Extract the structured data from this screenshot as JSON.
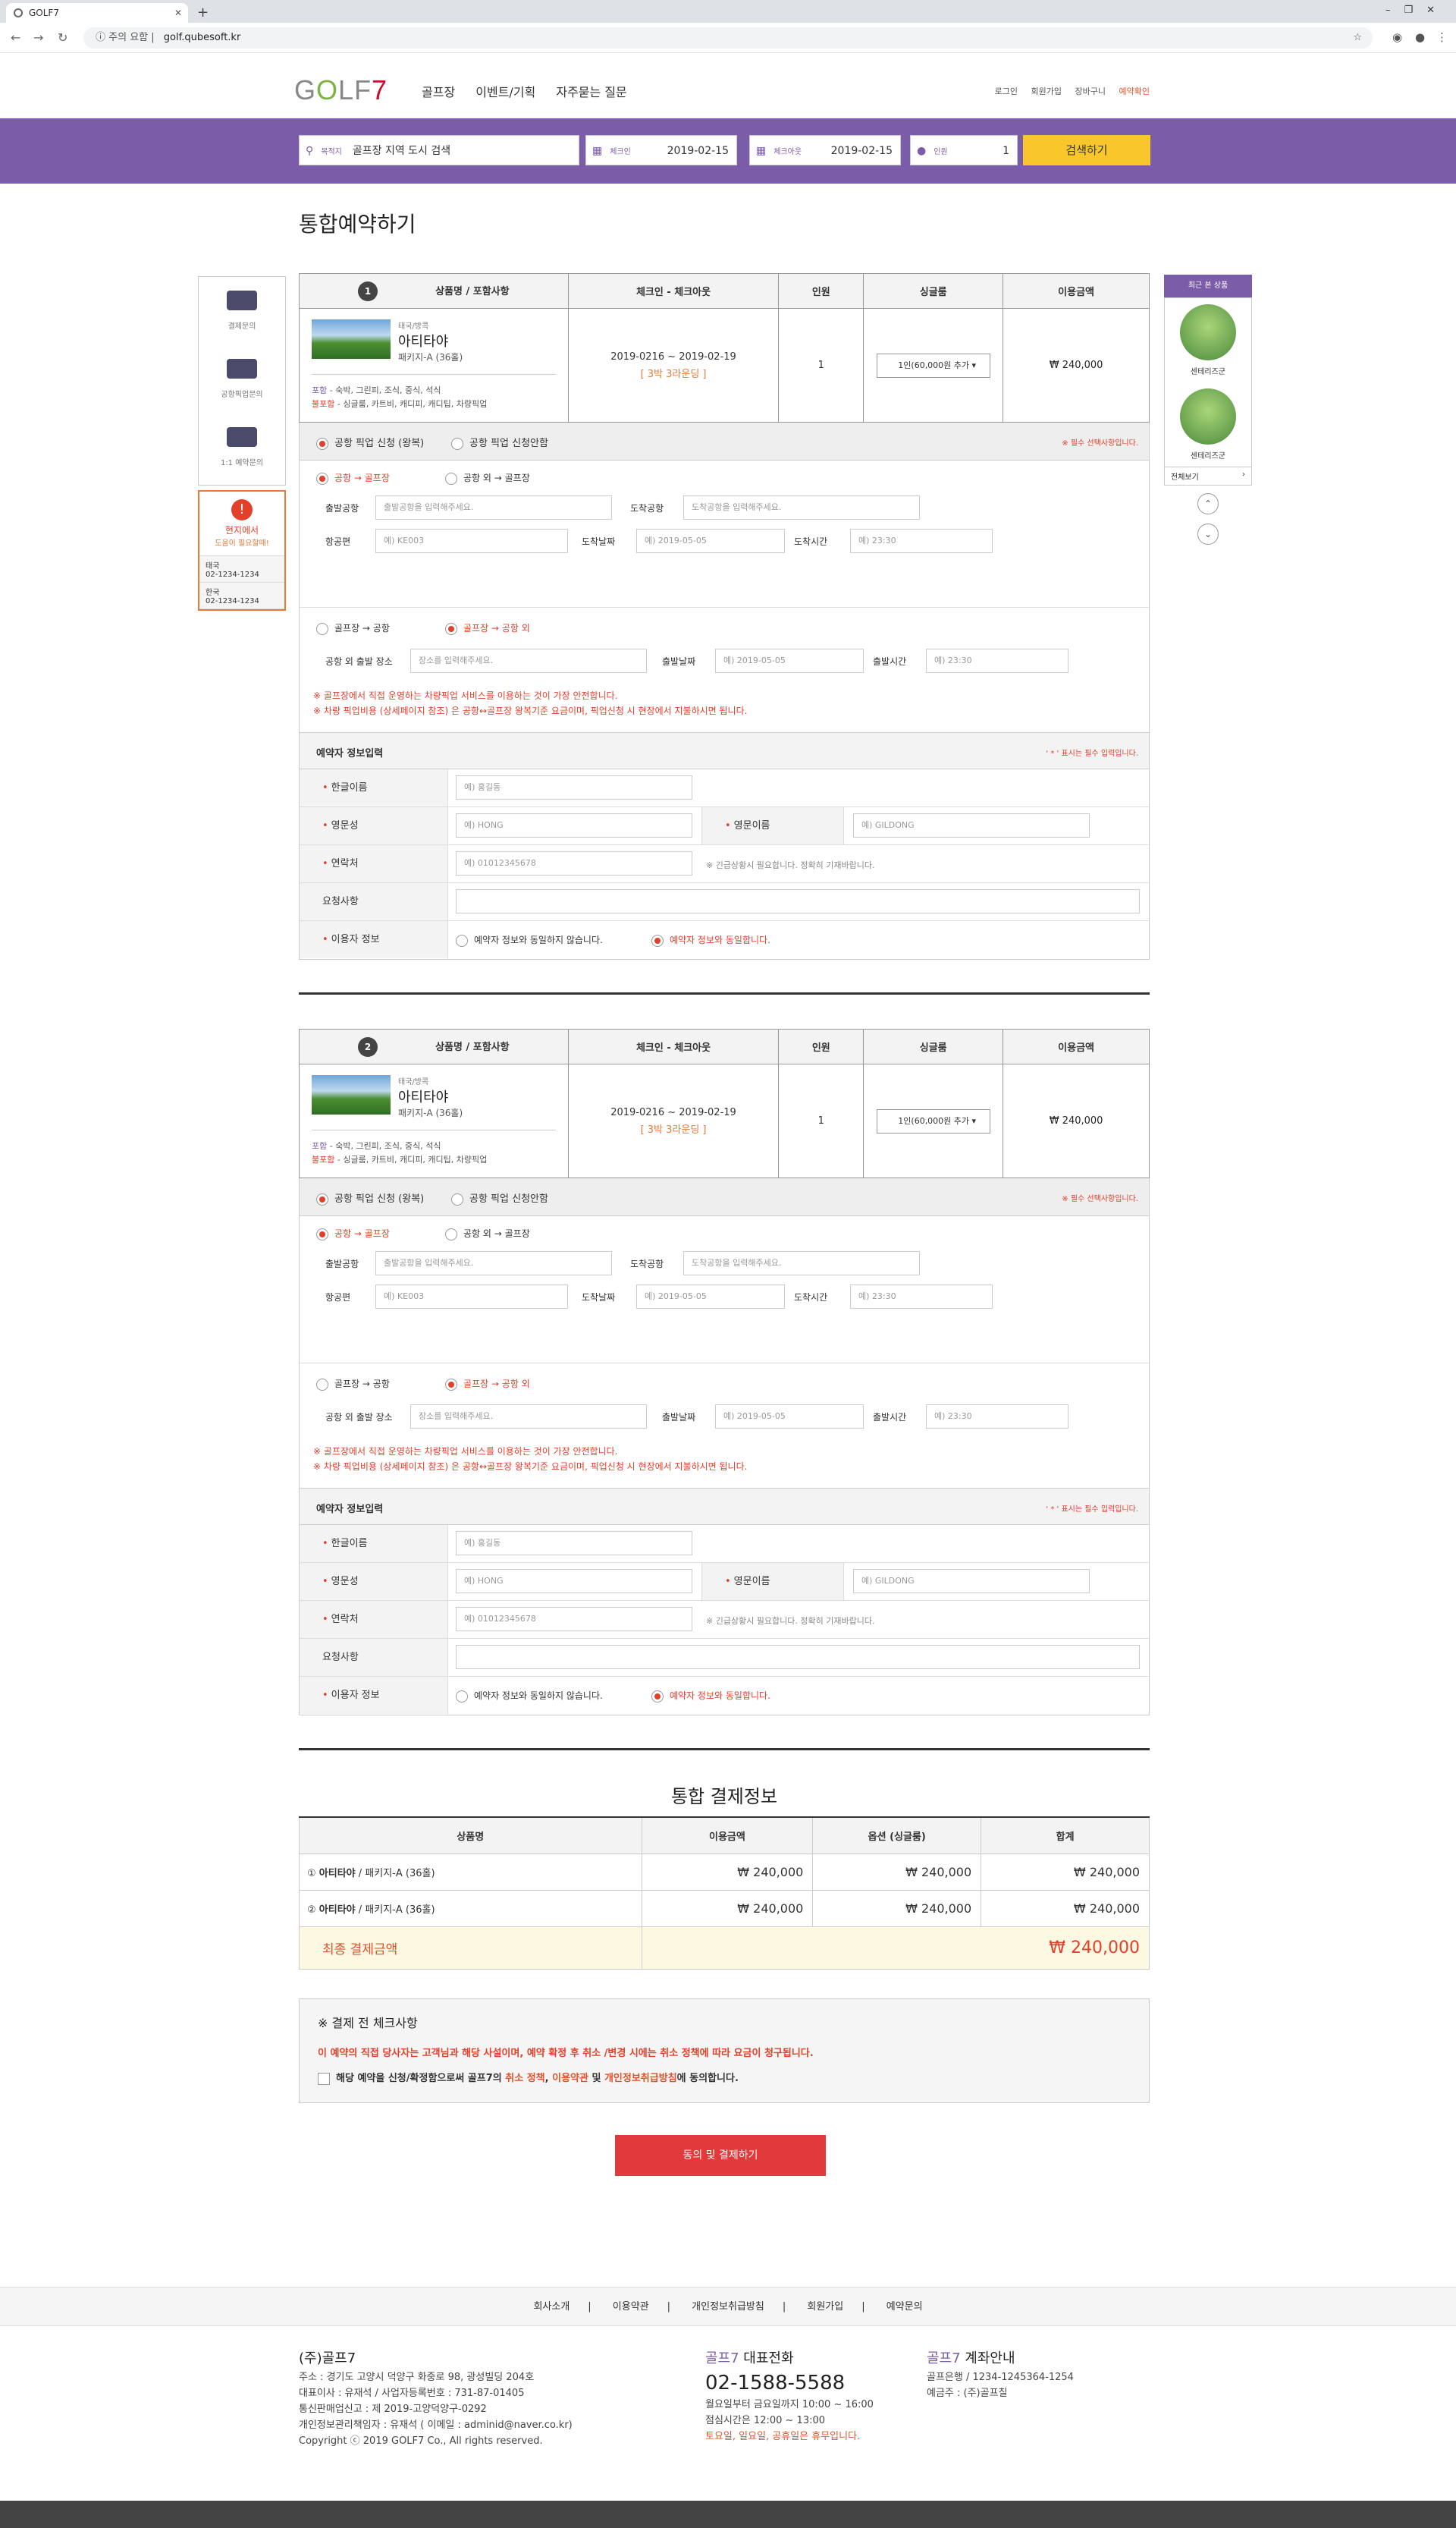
{
  "browser": {
    "tab_title": "GOLF7",
    "security": "주의 요함",
    "url": "golf.qubesoft.kr"
  },
  "header": {
    "logo": {
      "g": "G",
      "o": "O",
      "lf": "LF",
      "seven": "7"
    },
    "nav": [
      "골프장",
      "이벤트/기획",
      "자주묻는 질문"
    ],
    "util": [
      "로그인",
      "회원가입",
      "장바구니",
      "예약확인"
    ]
  },
  "search": {
    "dest_label": "목적지",
    "dest_value": "골프장 지역 도시 검색",
    "checkin_label": "체크인",
    "checkin_value": "2019-02-15",
    "checkout_label": "체크아웃",
    "checkout_value": "2019-02-15",
    "pax_label": "인원",
    "pax_value": "1",
    "button": "검색하기"
  },
  "page_title": "통합예약하기",
  "left_side": {
    "items": [
      "결제문의",
      "공항픽업문의",
      "1:1 예약문의"
    ],
    "help_title": "현지에서",
    "help_sub": "도움이 필요할때!",
    "phones": [
      {
        "country": "태국",
        "number": "02-1234-1234"
      },
      {
        "country": "한국",
        "number": "02-1234-1234"
      }
    ]
  },
  "right_side": {
    "title": "최근 본 상품",
    "items": [
      "센테리즈군",
      "센테리즈군"
    ],
    "more": "전체보기"
  },
  "table_headers": [
    "상품명 / 포함사항",
    "체크인 - 체크아웃",
    "인원",
    "싱글룸",
    "이용금액"
  ],
  "bookings": [
    {
      "num": "1",
      "region": "태국/방콕",
      "name": "아티타야",
      "package": "패키지-A (36홀)",
      "inc_label": "포함",
      "inc_text": " - 숙박, 그린피, 조식, 중식, 석식",
      "exc_label": "불포함",
      "exc_text": " - 싱글룸, 카트비, 캐디피, 캐디팁, 차량픽업",
      "dates": "2019-0216 ~ 2019-02-19",
      "nights": "[ 3박 3라운딩 ]",
      "pax": "1",
      "single_room": "1인(60,000원 추가",
      "price": "₩ 240,000"
    },
    {
      "num": "2",
      "region": "태국/방콕",
      "name": "아티타야",
      "package": "패키지-A (36홀)",
      "inc_label": "포함",
      "inc_text": " - 숙박, 그린피, 조식, 중식, 석식",
      "exc_label": "불포함",
      "exc_text": " - 싱글룸, 카트비, 캐디피, 캐디팁, 차량픽업",
      "dates": "2019-0216 ~ 2019-02-19",
      "nights": "[ 3박 3라운딩 ]",
      "pax": "1",
      "single_room": "1인(60,000원 추가",
      "price": "₩ 240,000"
    }
  ],
  "pickup": {
    "apply": "공항 픽업 신청 (왕복)",
    "no_apply": "공항 픽업 신청안함",
    "required": "※ 필수 선택사항입니다.",
    "route1_on": "공항 → 골프장",
    "route1_off": "공항 외 → 골프장",
    "depart_airport": "출발공항",
    "depart_airport_ph": "출발공항을 입력해주세요.",
    "arrive_airport": "도착공항",
    "arrive_airport_ph": "도착공항을 입력해주세요.",
    "flight": "항공편",
    "flight_ph": "예) KE003",
    "arrive_date": "도착날짜",
    "arrive_date_ph": "예) 2019-05-05",
    "arrive_time": "도착시간",
    "arrive_time_ph": "예) 23:30",
    "route2_off": "골프장 → 공항",
    "route2_on": "골프장 → 공항 외",
    "place": "공항 외 출발 장소",
    "place_ph": "장소를 입력해주세요.",
    "depart_date": "출발날짜",
    "depart_date_ph": "예) 2019-05-05",
    "depart_time": "출발시간",
    "depart_time_ph": "예) 23:30",
    "notice1": "※ 골프장에서 직접 운영하는 차량픽업 서비스를 이용하는 것이 가장 안전합니다.",
    "notice2": "※ 차량 픽업비용 (상세페이지 참조) 은 공항↔골프장 왕복기준 요금이며, 픽업신청 시 현장에서 지불하시면 됩니다."
  },
  "booker": {
    "title": "예약자 정보입력",
    "required": "' * ' 표시는 필수 입력입니다.",
    "korean_name": "한글이름",
    "korean_name_ph": "예) 홍길동",
    "last_name": "영문성",
    "last_name_ph": "예) HONG",
    "first_name": "영문이름",
    "first_name_ph": "예) GILDONG",
    "contact": "연락처",
    "contact_ph": "예) 01012345678",
    "contact_note": "※ 긴급상황시 필요합니다. 정확히 기재바랍니다.",
    "request": "요청사항",
    "user_info": "이용자 정보",
    "not_same": "예약자 정보와 동일하지 않습니다.",
    "same": "예약자 정보와 동일합니다."
  },
  "payment": {
    "title": "통합 결제정보",
    "headers": [
      "상품명",
      "이용금액",
      "옵션 (싱글룸)",
      "합계"
    ],
    "rows": [
      {
        "num": "①",
        "name": "아티타야",
        "pkg": " / 패키지-A (36홀)",
        "amount": "₩ 240,000",
        "option": "₩ 240,000",
        "total": "₩ 240,000"
      },
      {
        "num": "②",
        "name": "아티타야",
        "pkg": " / 패키지-A (36홀)",
        "amount": "₩ 240,000",
        "option": "₩ 240,000",
        "total": "₩ 240,000"
      }
    ],
    "final_label": "최종 결제금액",
    "final_value": "₩ 240,000"
  },
  "checks": {
    "title": "※ 결제 전 체크사항",
    "warning": "이 예약의 직접 당사자는 고객님과 해당 사설이며, 예약 확정 후 취소 /변경 시에는 취소 정책에 따라 요금이 청구됩니다.",
    "agree_pre": "해당 예약을 신청/확정함으로써 골프7의 ",
    "agree_l1": "취소 정책",
    "agree_c1": ", ",
    "agree_l2": "이용약관",
    "agree_c2": " 및 ",
    "agree_l3": "개인정보취급방침",
    "agree_post": "에 동의합니다."
  },
  "pay_button": "동의 및 결제하기",
  "footer": {
    "links": [
      "회사소개",
      "이용약관",
      "개인정보취급방침",
      "회원가입",
      "예약문의"
    ],
    "company": "(주)골프7",
    "address": "주소 : 경기도 고양시 덕양구 화중로 98, 광성빌딩 204호",
    "ceo": "대표이사 : 유재석  /  사업자등록번호 : 731-87-01405",
    "mail_order": "통신판매업신고 : 제 2019-고양덕양구-0292",
    "privacy": "개인정보관리책임자 : 유재석 ( 이메일 : adminid@naver.co.kr)",
    "copyright": "Copyright ⓒ 2019 GOLF7 Co., All rights reserved.",
    "call_brand": "골프7",
    "call_title": " 대표전화",
    "call_number": "02-1588-5588",
    "call_hours1": "월요일부터 금요일까지 10:00 ~ 16:00",
    "call_hours2": "점심시간은 12:00 ~ 13:00",
    "call_closed": "토요일, 일요일, 공휴일은 휴무입니다.",
    "bank_brand": "골프7",
    "bank_title": " 계좌안내",
    "bank_account": "골프은행  /  1234-1245364-1254",
    "bank_holder": "예금주 : (주)골프칠"
  }
}
